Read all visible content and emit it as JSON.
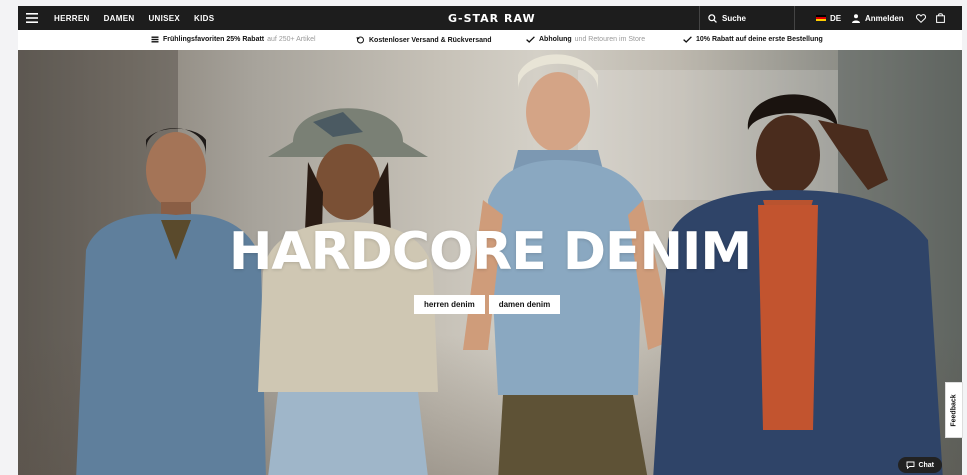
{
  "nav": {
    "links": [
      "HERREN",
      "DAMEN",
      "UNISEX",
      "KIDS"
    ],
    "logo": "G-STAR RAW",
    "search_label": "Suche",
    "language": "DE",
    "login_label": "Anmelden"
  },
  "promo": {
    "item1_bold": "Frühlingsfavoriten 25% Rabatt",
    "item1_light": "auf 250+ Artikel",
    "item2_bold": "Kostenloser Versand & Rückversand",
    "item3_bold": "Abholung",
    "item3_light": "und Retouren im Store",
    "item4_bold": "10% Rabatt auf deine erste Bestellung"
  },
  "hero": {
    "headline": "HARDCORE DENIM",
    "cta_men": "herren denim",
    "cta_women": "damen denim"
  },
  "widgets": {
    "feedback": "Feedback",
    "chat": "Chat"
  },
  "colors": {
    "nav_bg": "#1d1d1d",
    "flag_black": "#000000",
    "flag_red": "#dd0000",
    "flag_gold": "#ffce00"
  }
}
